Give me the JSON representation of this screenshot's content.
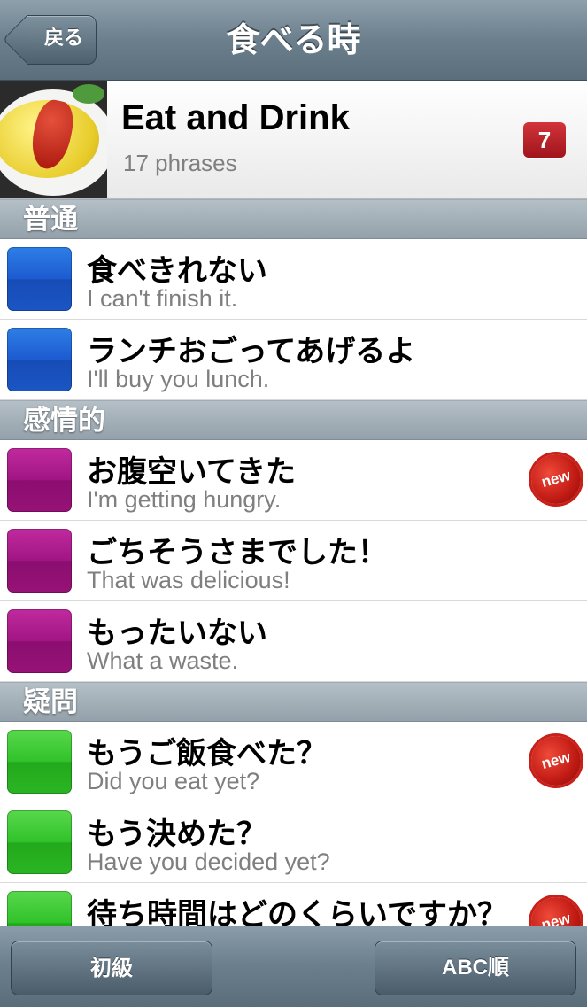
{
  "navbar": {
    "back_label": "戻る",
    "title": "食べる時"
  },
  "header": {
    "title": "Eat and Drink",
    "subtitle": "17 phrases",
    "badge": "7"
  },
  "sections": [
    {
      "title": "普通",
      "color": "#1c5bd0",
      "rows": [
        {
          "jp": "食べきれない",
          "en": "I can't finish it.",
          "new": false
        },
        {
          "jp": "ランチおごってあげるよ",
          "en": "I'll buy you lunch.",
          "new": false
        }
      ]
    },
    {
      "title": "感情的",
      "color": "#a11583",
      "rows": [
        {
          "jp": "お腹空いてきた",
          "en": "I'm getting hungry.",
          "new": true
        },
        {
          "jp": "ごちそうさまでした！",
          "en": "That was delicious!",
          "new": false
        },
        {
          "jp": "もったいない",
          "en": "What a waste.",
          "new": false
        }
      ]
    },
    {
      "title": "疑問",
      "color": "#31c22a",
      "rows": [
        {
          "jp": "もうご飯食べた？",
          "en": "Did you eat yet?",
          "new": true
        },
        {
          "jp": "もう決めた？",
          "en": "Have you decided yet?",
          "new": false
        },
        {
          "jp": "待ち時間はどのくらいですか？",
          "en": "",
          "new": true
        }
      ]
    }
  ],
  "new_label": "new",
  "toolbar": {
    "left_label": "初級",
    "right_label": "ABC順"
  }
}
